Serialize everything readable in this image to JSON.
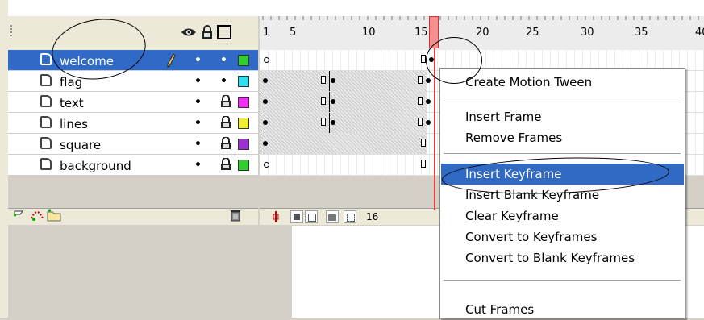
{
  "ruler": {
    "ticks": [
      "1",
      "5",
      "10",
      "15",
      "20",
      "25",
      "30",
      "35",
      "40"
    ]
  },
  "layers": [
    {
      "name": "welcome",
      "color": "#33cc33",
      "selected": true
    },
    {
      "name": "flag",
      "color": "#33ddee",
      "selected": false
    },
    {
      "name": "text",
      "color": "#ee33ee",
      "selected": false
    },
    {
      "name": "lines",
      "color": "#eeee33",
      "selected": false
    },
    {
      "name": "square",
      "color": "#9933cc",
      "selected": false
    },
    {
      "name": "background",
      "color": "#33cc33",
      "selected": false
    }
  ],
  "footer": {
    "current_frame": "16"
  },
  "context_menu": {
    "items": [
      "Create Motion Tween",
      "Insert Frame",
      "Remove Frames",
      "Insert Keyframe",
      "Insert Blank Keyframe",
      "Clear Keyframe",
      "Convert to Keyframes",
      "Convert to Blank Keyframes",
      "Cut Frames"
    ],
    "highlighted": "Insert Keyframe"
  },
  "colors": {
    "selection": "#3169c6",
    "playhead": "#e34040"
  }
}
